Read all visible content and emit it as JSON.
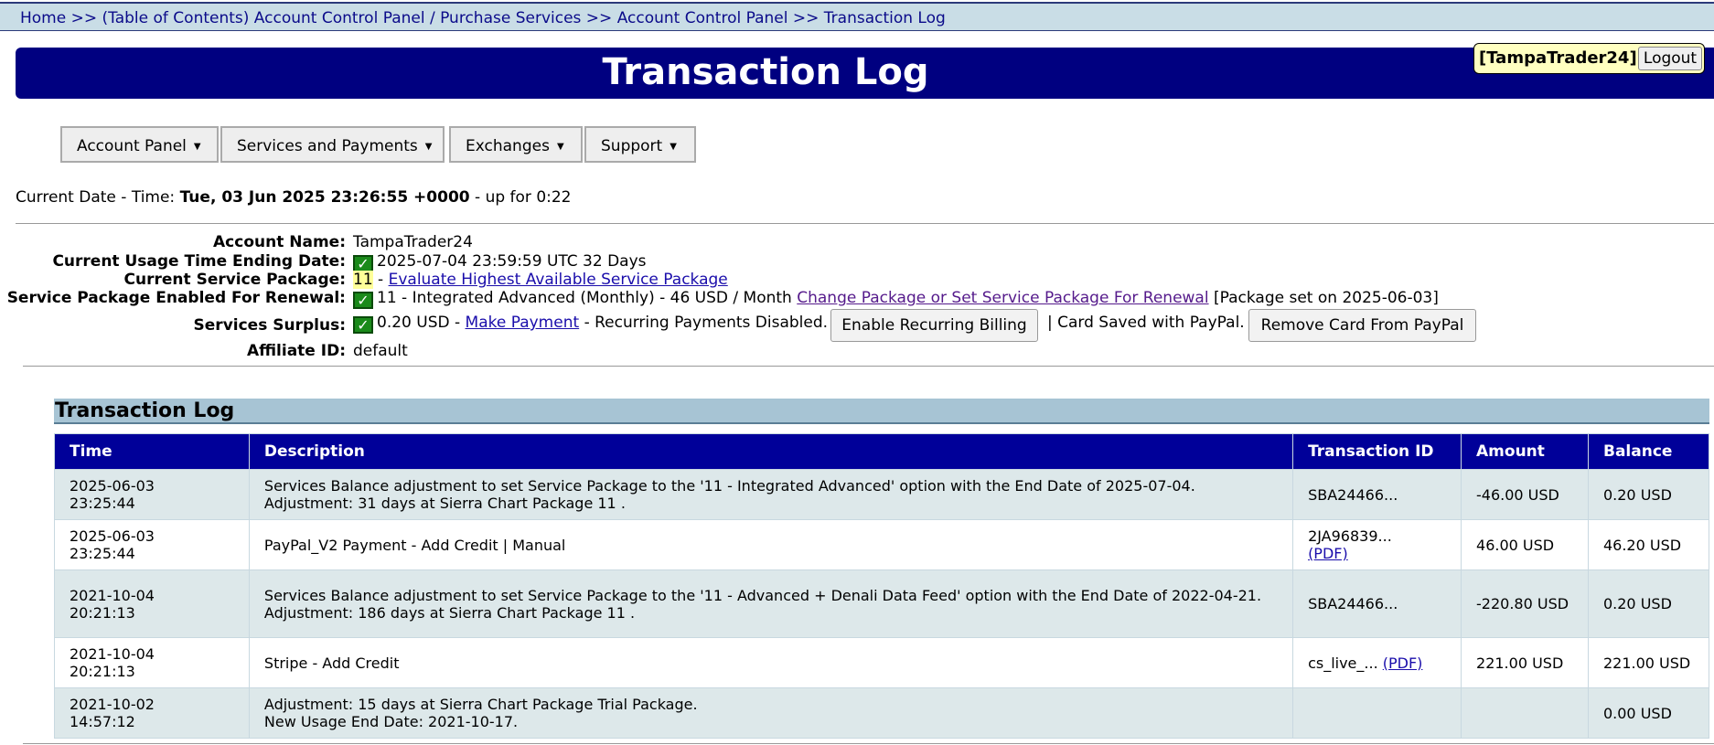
{
  "breadcrumb": {
    "home": "Home",
    "sep": ">>",
    "toc": "(Table of Contents) Account Control Panel / Purchase Services",
    "acp": "Account Control Panel",
    "current": "Transaction Log"
  },
  "header": {
    "title": "Transaction Log",
    "username": "[TampaTrader24]",
    "logout": "Logout"
  },
  "menu": {
    "items": [
      "Account Panel",
      "Services and Payments",
      "Exchanges",
      "Support"
    ],
    "caret": "▼"
  },
  "datetime": {
    "label": "Current Date - Time:",
    "value": "Tue, 03 Jun 2025 23:26:55 +0000",
    "uptime": "- up for 0:22"
  },
  "account": {
    "name_label": "Account Name:",
    "name": "TampaTrader24",
    "usage_label": "Current Usage Time Ending Date:",
    "usage": "2025-07-04 23:59:59 UTC 32 Days",
    "package_label": "Current Service Package:",
    "package_num": "11",
    "package_dash": " - ",
    "evaluate_link": "Evaluate Highest Available Service Package",
    "renewal_label": "Service Package Enabled For Renewal:",
    "renewal_text": "11 - Integrated Advanced (Monthly) - 46 USD / Month",
    "change_link": "Change Package or Set Service Package For Renewal",
    "package_set": "[Package set on 2025-06-03]",
    "surplus_label": "Services Surplus:",
    "surplus_amount": "0.20 USD - ",
    "make_payment": "Make Payment",
    "recurring_text": "- Recurring Payments Disabled.",
    "enable_recurring": "Enable Recurring Billing",
    "card_saved": "| Card Saved with PayPal.",
    "remove_card": "Remove Card From PayPal",
    "affiliate_label": "Affiliate ID:",
    "affiliate": "default",
    "check_glyph": "✓"
  },
  "log": {
    "title": "Transaction Log",
    "columns": [
      "Time",
      "Description",
      "Transaction ID",
      "Amount",
      "Balance"
    ],
    "rows": [
      {
        "date": "2025-06-03",
        "time": "23:25:44",
        "desc1": "Services Balance adjustment to set Service Package to the '11 - Integrated Advanced' option with the End Date of 2025-07-04.",
        "desc2": "Adjustment: 31 days at Sierra Chart Package 11 .",
        "txid": "SBA24466...",
        "pdf": "",
        "amount": "-46.00 USD",
        "balance": "0.20 USD"
      },
      {
        "date": "2025-06-03",
        "time": "23:25:44",
        "desc1": "PayPal_V2 Payment - Add Credit | Manual",
        "desc2": "",
        "txid": "2JA96839...",
        "pdf": "(PDF)",
        "amount": "46.00 USD",
        "balance": "46.20 USD"
      },
      {
        "date": "2021-10-04",
        "time": "20:21:13",
        "desc1": "Services Balance adjustment to set Service Package to the '11 - Advanced + Denali Data Feed' option with the End Date of 2022-04-21.",
        "desc2": "Adjustment: 186 days at Sierra Chart Package 11 .",
        "txid": "SBA24466...",
        "pdf": "",
        "amount": "-220.80 USD",
        "balance": "0.20 USD"
      },
      {
        "date": "2021-10-04",
        "time": "20:21:13",
        "desc1": "Stripe - Add Credit",
        "desc2": "",
        "txid": "cs_live_...",
        "pdf": "(PDF)",
        "amount": "221.00 USD",
        "balance": "221.00 USD"
      },
      {
        "date": "2021-10-02",
        "time": "14:57:12",
        "desc1": "Adjustment: 15 days at Sierra Chart Package Trial Package.",
        "desc2": "New Usage End Date: 2021-10-17.",
        "txid": "",
        "pdf": "",
        "amount": "",
        "balance": "0.00 USD"
      }
    ]
  }
}
